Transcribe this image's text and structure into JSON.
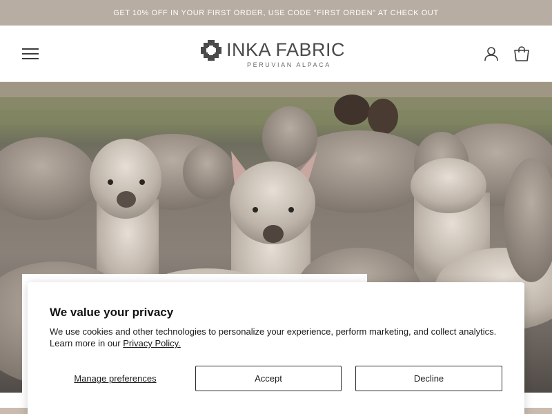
{
  "announcement": {
    "text": "GET 10% OFF IN YOUR FIRST ORDER, USE CODE \"FIRST ORDEN\" AT CHECK OUT"
  },
  "header": {
    "logo_name": "INKA FABRIC",
    "logo_tagline": "PERUVIAN ALPACA",
    "menu_icon": "hamburger-menu-icon",
    "account_icon": "user-account-icon",
    "cart_icon": "shopping-bag-icon"
  },
  "hero": {
    "image_subject": "herd of alpacas in highland pasture"
  },
  "cookie_banner": {
    "title": "We value your privacy",
    "body": "We use cookies and other technologies to personalize your experience, perform marketing, and collect analytics. Learn more in our ",
    "policy_link": "Privacy Policy.",
    "manage_label": "Manage preferences",
    "accept_label": "Accept",
    "decline_label": "Decline"
  },
  "colors": {
    "announcement_bg": "#b8ada2",
    "bottom_band": "#c9bcaf",
    "button_border": "#2a2a2a"
  }
}
